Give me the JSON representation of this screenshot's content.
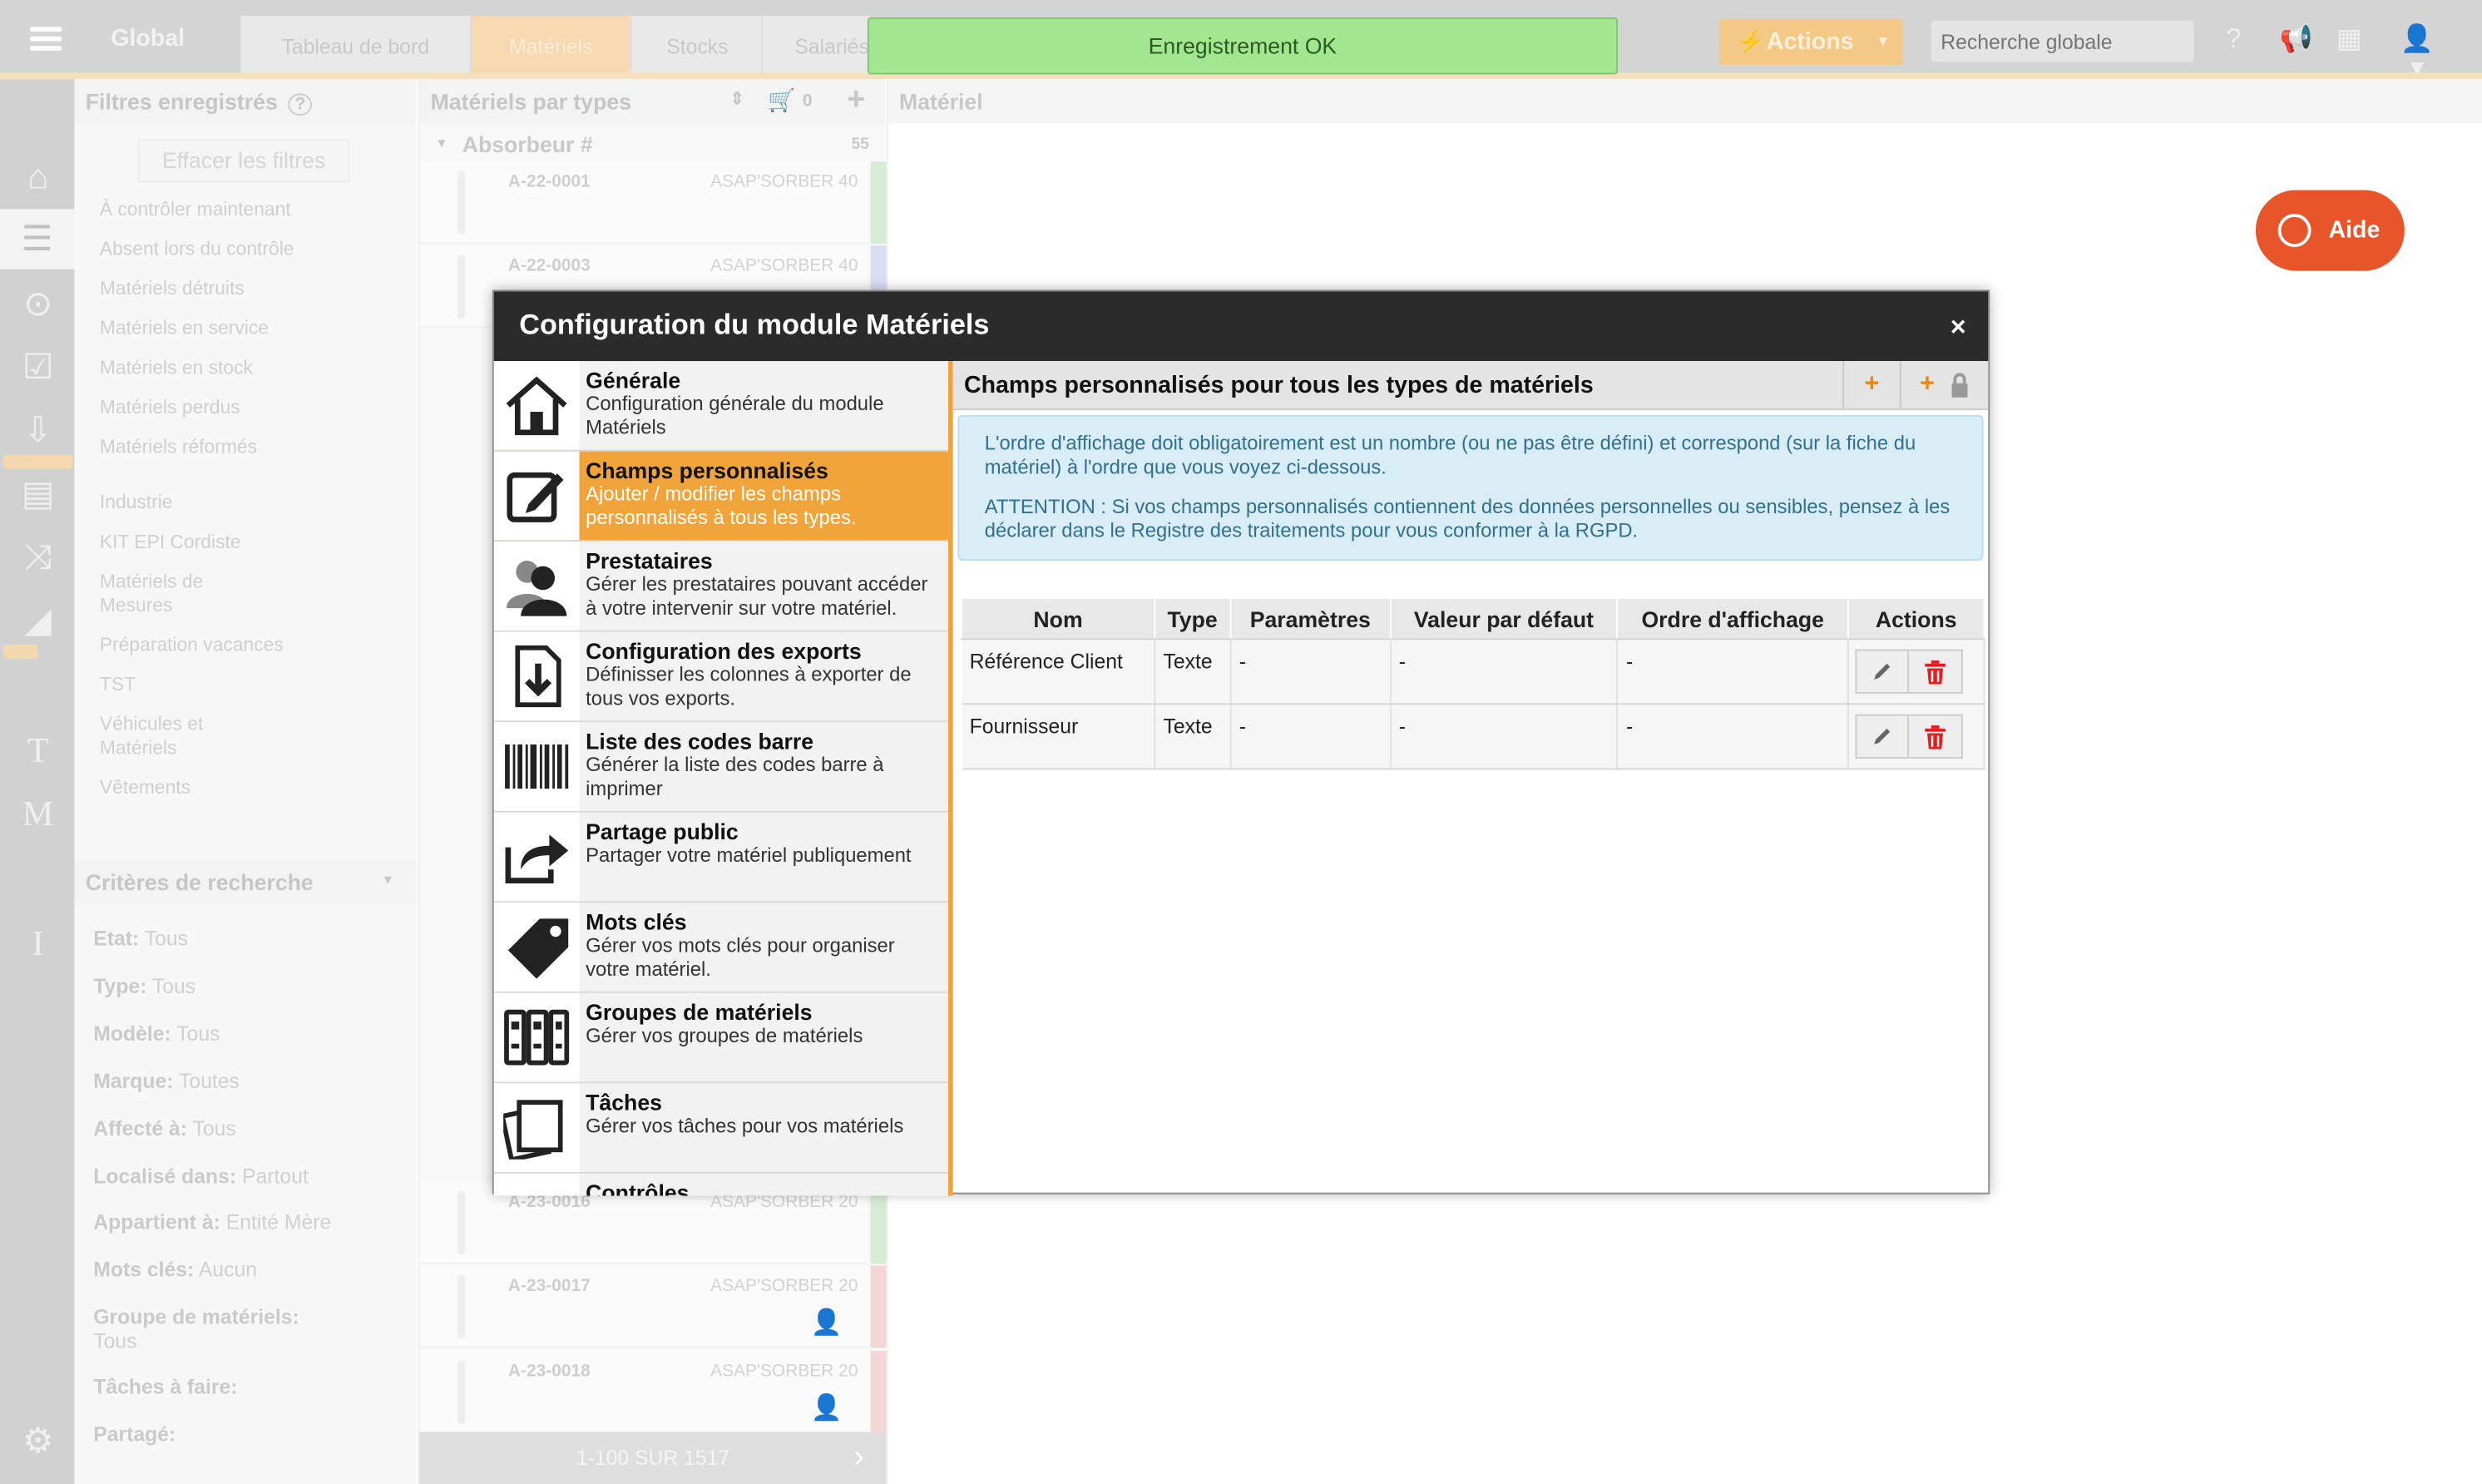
{
  "topbar": {
    "app_name": "Global",
    "tabs": [
      {
        "label": "Tableau de bord"
      },
      {
        "label": "Matériels"
      },
      {
        "label": "Stocks"
      },
      {
        "label": "Salariés"
      }
    ],
    "actions_label": "Actions",
    "search_placeholder": "Recherche globale"
  },
  "toast": {
    "message": "Enregistrement OK"
  },
  "filters": {
    "title": "Filtres enregistrés",
    "clear_label": "Effacer les filtres",
    "items": [
      "À contrôler maintenant",
      "Absent lors du contrôle",
      "Matériels détruits",
      "Matériels en service",
      "Matériels en stock",
      "Matériels perdus",
      "Matériels réformés",
      "Industrie",
      "KIT EPI Cordiste",
      "Matériels de Mesures",
      "Préparation vacances",
      "TST",
      "Véhicules et Matériels",
      "Vêtements"
    ],
    "criteria_title": "Critères de recherche",
    "criteria": [
      {
        "label": "Etat:",
        "value": "Tous"
      },
      {
        "label": "Type:",
        "value": "Tous"
      },
      {
        "label": "Modèle:",
        "value": "Tous"
      },
      {
        "label": "Marque:",
        "value": "Toutes"
      },
      {
        "label": "Affecté à:",
        "value": "Tous"
      },
      {
        "label": "Localisé dans:",
        "value": "Partout"
      },
      {
        "label": "Appartient à:",
        "value": "Entité Mère"
      },
      {
        "label": "Mots clés:",
        "value": "Aucun"
      },
      {
        "label": "Groupe de matériels:",
        "value": "Tous"
      },
      {
        "label": "Tâches à faire:",
        "value": ""
      },
      {
        "label": "Partagé:",
        "value": ""
      }
    ]
  },
  "list": {
    "title": "Matériels par types",
    "cart_count": "0",
    "group_name": "Absorbeur #",
    "group_count": "55",
    "items": [
      {
        "ref": "A-22-0001",
        "model": "ASAP'SORBER 40"
      },
      {
        "ref": "A-22-0003",
        "model": "ASAP'SORBER 40"
      },
      {
        "ref": "A-23-0016",
        "model": "ASAP'SORBER 20"
      },
      {
        "ref": "A-23-0017",
        "model": "ASAP'SORBER 20"
      },
      {
        "ref": "A-23-0018",
        "model": "ASAP'SORBER 20"
      }
    ],
    "pager": "1-100 SUR 1517"
  },
  "main": {
    "title": "Matériel",
    "help_label": "Aide"
  },
  "modal": {
    "title": "Configuration du module Matériels",
    "close_label": "×",
    "nav": [
      {
        "title": "Générale",
        "desc": "Configuration générale du module Matériels",
        "icon": "home-icon"
      },
      {
        "title": "Champs personnalisés",
        "desc": "Ajouter / modifier les champs personnalisés à tous les types.",
        "icon": "edit-icon"
      },
      {
        "title": "Prestataires",
        "desc": "Gérer les prestataires pouvant accéder à votre intervenir sur votre matériel.",
        "icon": "users-icon"
      },
      {
        "title": "Configuration des exports",
        "desc": "Définisser les colonnes à exporter de tous vos exports.",
        "icon": "export-icon"
      },
      {
        "title": "Liste des codes barre",
        "desc": "Générer la liste des codes barre à imprimer",
        "icon": "barcode-icon"
      },
      {
        "title": "Partage public",
        "desc": "Partager votre matériel publiquement",
        "icon": "share-icon"
      },
      {
        "title": "Mots clés",
        "desc": "Gérer vos mots clés pour organiser votre matériel.",
        "icon": "tag-icon"
      },
      {
        "title": "Groupes de matériels",
        "desc": "Gérer vos groupes de matériels",
        "icon": "binders-icon"
      },
      {
        "title": "Tâches",
        "desc": "Gérer vos tâches pour vos matériels",
        "icon": "tasks-icon"
      },
      {
        "title": "Contrôles",
        "desc": "",
        "icon": "check-icon"
      }
    ],
    "content": {
      "title": "Champs personnalisés pour tous les types de matériels",
      "add_label": "+",
      "info_1": "L'ordre d'affichage doit obligatoirement est un nombre (ou ne pas être défini) et correspond (sur la fiche du matériel) à l'ordre que vous voyez ci-dessous.",
      "info_2": "ATTENTION : Si vos champs personnalisés contiennent des données personnelles ou sensibles, pensez à les déclarer dans le Registre des traitements pour vous conformer à la RGPD.",
      "columns": [
        "Nom",
        "Type",
        "Paramètres",
        "Valeur par défaut",
        "Ordre d'affichage",
        "Actions"
      ],
      "rows": [
        {
          "nom": "Référence Client",
          "type": "Texte",
          "params": "-",
          "default": "-",
          "order": "-"
        },
        {
          "nom": "Fournisseur",
          "type": "Texte",
          "params": "-",
          "default": "-",
          "order": "-"
        }
      ]
    }
  },
  "colors": {
    "accent": "#f0a43a",
    "header_dark": "#2b2b2b",
    "delete_red": "#e02020",
    "help_orange": "#e9552a",
    "toast_green": "#a2e68f"
  }
}
